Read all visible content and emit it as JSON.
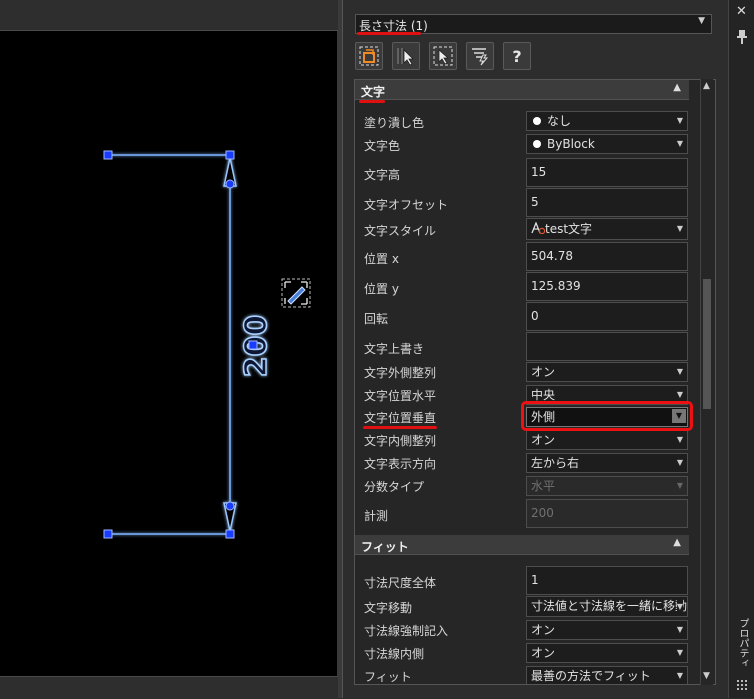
{
  "canvas": {
    "dimension_text": "200"
  },
  "panel": {
    "title": "長さ寸法 (1)",
    "toolbar": [
      {
        "icon": "quick-select-icon"
      },
      {
        "icon": "select-objects-icon"
      },
      {
        "icon": "toggle-pickadd-icon"
      },
      {
        "icon": "properties-filter-icon"
      },
      {
        "icon": "help-icon",
        "label": "?"
      }
    ],
    "sections": [
      {
        "name": "文字",
        "rows": [
          {
            "key": "塗り潰し色",
            "value": "なし",
            "type": "dropdown",
            "swatch": "#ffffff"
          },
          {
            "key": "文字色",
            "value": "ByBlock",
            "type": "dropdown",
            "swatch": "#ffffff"
          },
          {
            "key": "文字高",
            "value": "15",
            "type": "text"
          },
          {
            "key": "文字オフセット",
            "value": "5",
            "type": "text"
          },
          {
            "key": "文字スタイル",
            "value": "test文字",
            "type": "dropdown",
            "icon": "text-style-icon"
          },
          {
            "key": "位置 x",
            "value": "504.78",
            "type": "text"
          },
          {
            "key": "位置 y",
            "value": "125.839",
            "type": "text"
          },
          {
            "key": "回転",
            "value": "0",
            "type": "text"
          },
          {
            "key": "文字上書き",
            "value": "",
            "type": "text"
          },
          {
            "key": "文字外側整列",
            "value": "オン",
            "type": "dropdown"
          },
          {
            "key": "文字位置水平",
            "value": "中央",
            "type": "dropdown"
          },
          {
            "key": "文字位置垂直",
            "value": "外側",
            "type": "dropdown",
            "highlight": true
          },
          {
            "key": "文字内側整列",
            "value": "オン",
            "type": "dropdown"
          },
          {
            "key": "文字表示方向",
            "value": "左から右",
            "type": "dropdown"
          },
          {
            "key": "分数タイプ",
            "value": "水平",
            "type": "dropdown",
            "disabled": true
          },
          {
            "key": "計測",
            "value": "200",
            "type": "text",
            "disabled": true
          }
        ]
      },
      {
        "name": "フィット",
        "rows": [
          {
            "key": "寸法尺度全体",
            "value": "1",
            "type": "text"
          },
          {
            "key": "文字移動",
            "value": "寸法値と寸法線を一緒に移動",
            "type": "dropdown"
          },
          {
            "key": "寸法線強制記入",
            "value": "オン",
            "type": "dropdown"
          },
          {
            "key": "寸法線内側",
            "value": "オン",
            "type": "dropdown"
          },
          {
            "key": "フィット",
            "value": "最善の方法でフィット",
            "type": "dropdown"
          }
        ]
      }
    ]
  },
  "strip": {
    "close": "✕",
    "tab_label": "プロパティ"
  },
  "colors": {
    "highlight": "#ee1111",
    "dimension": "#7fb4ff",
    "grip": "#1a3cff"
  }
}
